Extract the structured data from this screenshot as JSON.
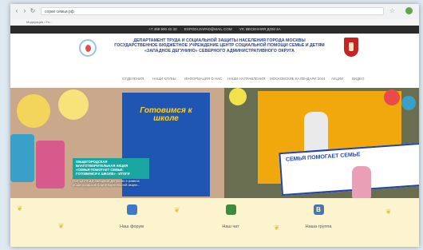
{
  "browser": {
    "tab_title": "",
    "address": "сорки семьи.рф",
    "bookmarks_label": "Модерация • Гл..."
  },
  "topbar": {
    "phone": "+7 499 900 42 33",
    "email": "ESPODI.ZAPAD@MAIL.COM",
    "address": "УЛ. ВЕСЕННЯЯ ДОМ 4А"
  },
  "header": {
    "title_lines": [
      "ДЕПАРТАМЕНТ ТРУДА И СОЦИАЛЬНОЙ ЗАЩИТЫ НАСЕЛЕНИЯ ГОРОДА МОСКВЫ",
      "ГОСУДАРСТВЕННОЕ БЮДЖЕТНОЕ УЧРЕЖДЕНИЕ ЦЕНТР СОЦИАЛЬНОЙ ПОМОЩИ СЕМЬЕ И ДЕТЯМ",
      "«ЗАПАДНОЕ ДЕГУНИНО» СЕВЕРНОГО АДМИНИСТРАТИВНОГО ОКРУГА"
    ]
  },
  "nav": {
    "items": [
      "ОТДЕЛЕНИЯ",
      "НАШИ КЛУБЫ",
      "ИНФОРМАЦИЯ О НАС",
      "НАШИ НАПРАВЛЕНИЯ",
      "МОСКОВСКИЕ КАЛЕНДАРИ 2024",
      "АКЦИИ",
      "ВИДЕО"
    ]
  },
  "slide": {
    "poster_title": "Готовимся к школе",
    "caption_lines": [
      "ОБЩЕГОРОДСКАЯ",
      "БЛАГОТВОРИТЕЛЬНАЯ АКЦИЯ",
      "«СЕМЬЯ ПОМОГАЕТ СЕМЬЕ:",
      "ГОТОВИМСЯ К ШКОЛЕ» - ИТОГИ"
    ],
    "sub_lines": [
      "ГБУ ЦСПСиД Западное Дегунино в рамках",
      "общегородской благотворительной акции..."
    ],
    "banner_text": "СЕМЬЯ ПОМОГАЕТ СЕМЬЕ"
  },
  "footer": {
    "items": [
      {
        "label": "Наш форум",
        "icon": "forum-icon",
        "color": "#3f7ac8"
      },
      {
        "label": "Наш чат",
        "icon": "chat-icon",
        "color": "#3d8b3d"
      },
      {
        "label": "Наша группа",
        "icon": "vk-icon",
        "color": "#4a76a8"
      }
    ]
  }
}
